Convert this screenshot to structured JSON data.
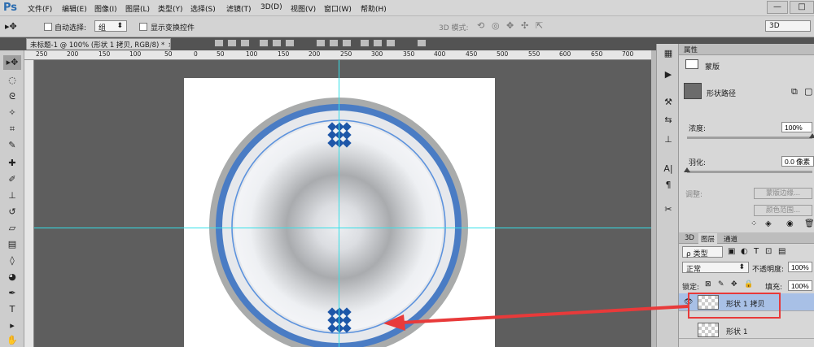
{
  "app": {
    "logo": "Ps"
  },
  "menu": [
    "文件(F)",
    "编辑(E)",
    "图像(I)",
    "图层(L)",
    "类型(Y)",
    "选择(S)",
    "滤镜(T)",
    "3D(D)",
    "视图(V)",
    "窗口(W)",
    "帮助(H)"
  ],
  "window_controls": {
    "minimize": "—",
    "restore": "□",
    "close": "✕"
  },
  "options": {
    "auto_select_label": "自动选择:",
    "auto_select_value": "组",
    "show_transform_label": "显示变换控件",
    "mode3d_label": "3D 模式:",
    "workspace": "3D"
  },
  "document_tab": {
    "title": "未标题-1 @ 100% (形状 1 拷贝, RGB/8) *",
    "close": "×"
  },
  "ruler": {
    "ticks": [
      "250",
      "200",
      "150",
      "100",
      "50",
      "0",
      "50",
      "100",
      "150",
      "200",
      "250",
      "300",
      "350",
      "400",
      "450",
      "500",
      "550",
      "600",
      "650",
      "700"
    ]
  },
  "properties": {
    "title": "属性",
    "mask_label": "蒙版",
    "shape_path_label": "形状路径",
    "density_label": "浓度:",
    "density_value": "100%",
    "density_level": 1.0,
    "feather_label": "羽化:",
    "feather_value": "0.0 像素",
    "feather_level": 0.0,
    "adjust_label": "调整:",
    "mask_edge_button": "蒙版边缘...",
    "color_range_button": "颜色范围..."
  },
  "layers_panel": {
    "tabs": [
      "3D",
      "图层",
      "通道"
    ],
    "filter_kind": "ρ 类型",
    "blend_mode": "正常",
    "opacity_label": "不透明度:",
    "opacity_value": "100%",
    "lock_label": "锁定:",
    "fill_label": "填充:",
    "fill_value": "100%",
    "layers": [
      {
        "name": "形状 1 拷贝",
        "selected": true
      },
      {
        "name": "形状 1",
        "selected": false
      }
    ]
  },
  "colors": {
    "accent": "#2b6cb0",
    "highlight": "#e83a3a",
    "guide": "#34e0e8",
    "selected_row": "#a8c0e6"
  }
}
